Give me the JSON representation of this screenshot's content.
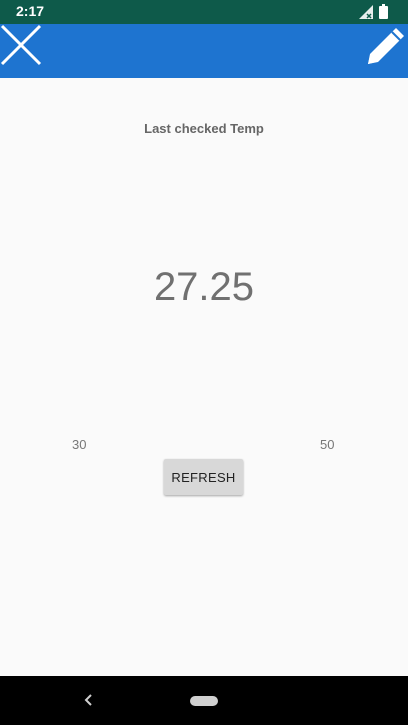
{
  "status_bar": {
    "time": "2:17",
    "icons": [
      "signal-icon",
      "battery-icon"
    ]
  },
  "app_bar": {
    "color": "#1e74d0",
    "left_icon": "close-icon",
    "right_icon": "pencil-icon"
  },
  "main": {
    "title": "Last checked Temp",
    "temperature": "27.25",
    "min_label": "30",
    "max_label": "50",
    "refresh_label": "REFRESH"
  },
  "nav_bar": {
    "icons": [
      "back-icon",
      "home-pill-icon"
    ]
  }
}
